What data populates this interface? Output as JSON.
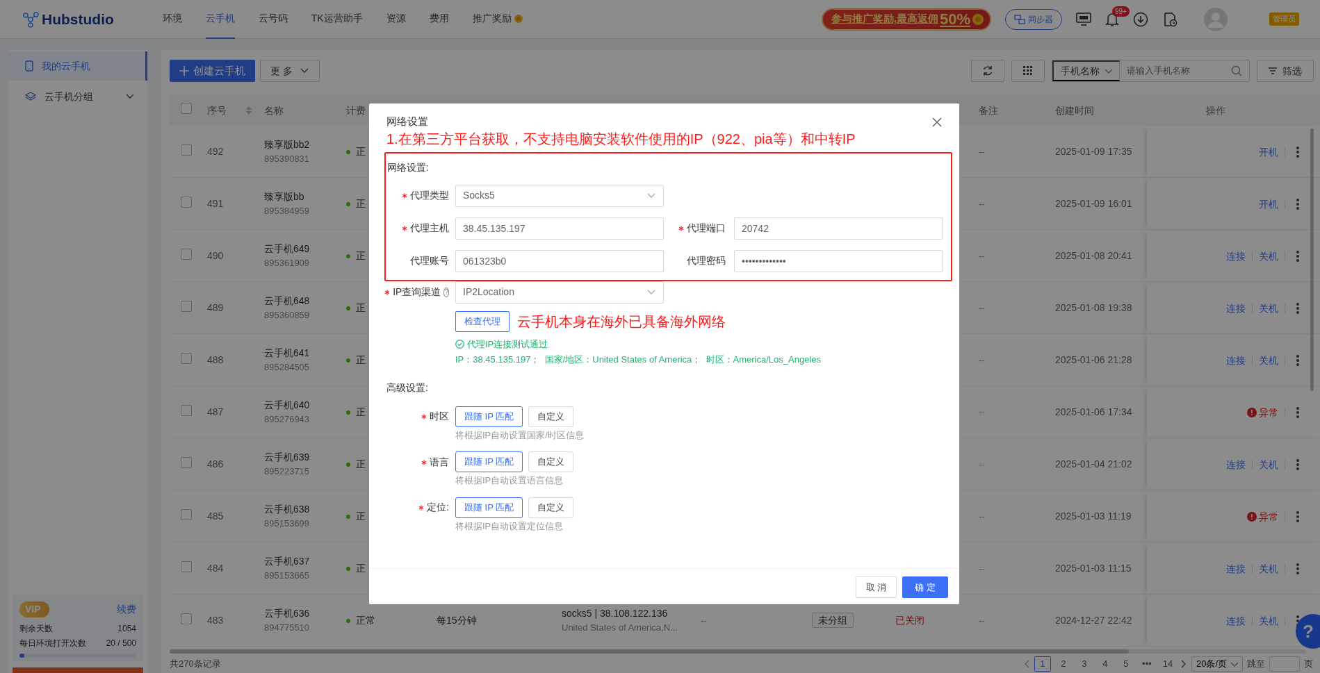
{
  "header": {
    "logo": "Hubstudio",
    "nav": [
      {
        "label": "环境",
        "selected": false,
        "kind": "plain"
      },
      {
        "label": "云手机",
        "selected": true,
        "kind": "plain"
      },
      {
        "label": "云号码",
        "selected": false,
        "kind": "plain"
      },
      {
        "label": "TK运营助手",
        "selected": false,
        "kind": "plain"
      },
      {
        "label": "资源",
        "selected": false,
        "kind": "plain"
      },
      {
        "label": "费用",
        "selected": false,
        "kind": "plain"
      },
      {
        "label": "推广奖励",
        "selected": false,
        "kind": "reward"
      }
    ],
    "promo": {
      "text": "参与推广奖励,最高返佣",
      "highlight": "50%"
    },
    "sync_button": "同步器",
    "notification_count": "99+",
    "role": "管理员"
  },
  "sidebar": {
    "items": [
      {
        "label": "我的云手机",
        "selected": true,
        "kind": "phone",
        "expandable": false
      },
      {
        "label": "云手机分组",
        "selected": false,
        "kind": "group",
        "expandable": true
      }
    ],
    "vip": {
      "badge": "VIP",
      "renew": "续费",
      "stats": [
        {
          "label": "剩余天数",
          "value": "1054"
        },
        {
          "label": "每日环境打开次数",
          "value": "20 / 500"
        }
      ],
      "level": 0.04
    }
  },
  "toolbar": {
    "create_button": "创建云手机",
    "more_button": "更 多",
    "search_select": "手机名称",
    "search": {
      "placeholder": "请输入手机名称"
    },
    "filter_button": "筛选"
  },
  "table": {
    "select_all_checked": false,
    "columns": {
      "seq": "序号",
      "name": "名称",
      "billing": "计费",
      "remark": "备注",
      "created": "创建时间",
      "actions": "操作"
    },
    "rows": [
      {
        "checked": false,
        "seq": "492",
        "name": "臻享版bb2",
        "id": "895390831",
        "status": "正",
        "remark": "--",
        "created": "2025-01-09 17:35",
        "actions": [
          {
            "kind": "link",
            "label": "开机"
          }
        ]
      },
      {
        "checked": false,
        "seq": "491",
        "name": "臻享版bb",
        "id": "895384959",
        "status": "正",
        "remark": "--",
        "created": "2025-01-09 16:01",
        "actions": [
          {
            "kind": "link",
            "label": "开机"
          }
        ]
      },
      {
        "checked": false,
        "seq": "490",
        "name": "云手机649",
        "id": "895361909",
        "status": "正",
        "remark": "--",
        "created": "2025-01-08 20:41",
        "actions": [
          {
            "kind": "link",
            "label": "连接"
          },
          {
            "kind": "link",
            "label": "关机"
          }
        ]
      },
      {
        "checked": false,
        "seq": "489",
        "name": "云手机648",
        "id": "895360859",
        "status": "正",
        "remark": "--",
        "created": "2025-01-08 19:38",
        "actions": [
          {
            "kind": "link",
            "label": "连接"
          },
          {
            "kind": "link",
            "label": "关机"
          }
        ]
      },
      {
        "checked": false,
        "seq": "488",
        "name": "云手机641",
        "id": "895284505",
        "status": "正",
        "remark": "--",
        "created": "2025-01-06 21:28",
        "actions": [
          {
            "kind": "link",
            "label": "连接"
          },
          {
            "kind": "link",
            "label": "关机"
          }
        ]
      },
      {
        "checked": false,
        "seq": "487",
        "name": "云手机640",
        "id": "895276943",
        "status": "正",
        "remark": "--",
        "created": "2025-01-06 17:34",
        "actions": [
          {
            "kind": "error",
            "label": "异常"
          }
        ]
      },
      {
        "checked": false,
        "seq": "486",
        "name": "云手机639",
        "id": "895223715",
        "status": "正",
        "remark": "--",
        "created": "2025-01-04 21:02",
        "actions": [
          {
            "kind": "link",
            "label": "连接"
          },
          {
            "kind": "link",
            "label": "关机"
          }
        ]
      },
      {
        "checked": false,
        "seq": "485",
        "name": "云手机638",
        "id": "895153699",
        "status": "正",
        "remark": "--",
        "created": "2025-01-03 11:19",
        "actions": [
          {
            "kind": "error",
            "label": "异常"
          }
        ]
      },
      {
        "checked": false,
        "seq": "484",
        "name": "云手机637",
        "id": "895153665",
        "status": "正",
        "remark": "--",
        "created": "2025-01-03 11:15",
        "actions": [
          {
            "kind": "link",
            "label": "连接"
          },
          {
            "kind": "link",
            "label": "关机"
          }
        ]
      },
      {
        "checked": false,
        "seq": "483",
        "name": "云手机636",
        "id": "894775510",
        "status": "正常",
        "billing": "每15分钟",
        "proxy": "socks5 | 38.108.122.136",
        "proxy_region": "United States of America,N...",
        "column_7": "--",
        "group": "未分组",
        "state": "已关闭",
        "remark": "--",
        "created": "2024-12-27 22:42",
        "actions": [
          {
            "kind": "link",
            "label": "连接"
          },
          {
            "kind": "link",
            "label": "关机"
          }
        ]
      }
    ]
  },
  "pagination": {
    "total": "共270条记录",
    "pages": [
      {
        "label": "1",
        "selected": true
      },
      {
        "label": "2",
        "selected": false
      },
      {
        "label": "3",
        "selected": false
      },
      {
        "label": "4",
        "selected": false
      },
      {
        "label": "5",
        "selected": false
      },
      {
        "label": "•••",
        "selected": false
      },
      {
        "label": "14",
        "selected": false
      }
    ],
    "page_size": "20条/页",
    "jump_label": "跳至",
    "page_unit": "页"
  },
  "modal": {
    "title": "网络设置",
    "annotation_top": "1.在第三方平台获取，不支持电脑安装软件使用的IP（922、pia等）和中转IP",
    "section_network": "网络设置:",
    "field_rows": [
      [
        {
          "label": "代理类型",
          "required": true,
          "kind": "select",
          "value": "Socks5"
        }
      ],
      [
        {
          "label": "代理主机",
          "required": true,
          "kind": "text",
          "value": "38.45.135.197"
        },
        {
          "label": "代理端口",
          "required": true,
          "kind": "text",
          "value": "20742"
        }
      ],
      [
        {
          "label": "代理账号",
          "required": false,
          "kind": "text",
          "value": "061323b0"
        },
        {
          "label": "代理密码",
          "required": false,
          "kind": "text",
          "value": "•••••••••••••"
        }
      ]
    ],
    "ip_query": {
      "label": "IP查询渠道",
      "required": true,
      "help_icon": "?",
      "value": "IP2Location"
    },
    "check_button": "检查代理",
    "annotation_side": "云手机本身在海外已具备海外网络",
    "success": "代理IP连接测试通过",
    "info": "IP：38.45.135.197；  国家/地区：United States of America；  时区：America/Los_Angeles",
    "section_advanced": "高级设置:",
    "advanced": [
      {
        "label": "时区",
        "required": true,
        "options": [
          {
            "label": "跟随 IP 匹配",
            "selected": true
          },
          {
            "label": "自定义",
            "selected": false
          }
        ],
        "hint": "将根据IP自动设置国家/时区信息"
      },
      {
        "label": "语言",
        "required": true,
        "options": [
          {
            "label": "跟随 IP 匹配",
            "selected": true
          },
          {
            "label": "自定义",
            "selected": false
          }
        ],
        "hint": "将根据IP自动设置语言信息"
      },
      {
        "label": "定位:",
        "required": true,
        "options": [
          {
            "label": "跟随 IP 匹配",
            "selected": true
          },
          {
            "label": "自定义",
            "selected": false
          }
        ],
        "hint": "将根据IP自动设置定位信息"
      }
    ],
    "cancel_button": "取 消",
    "ok_button": "确 定"
  },
  "help_button": "?"
}
